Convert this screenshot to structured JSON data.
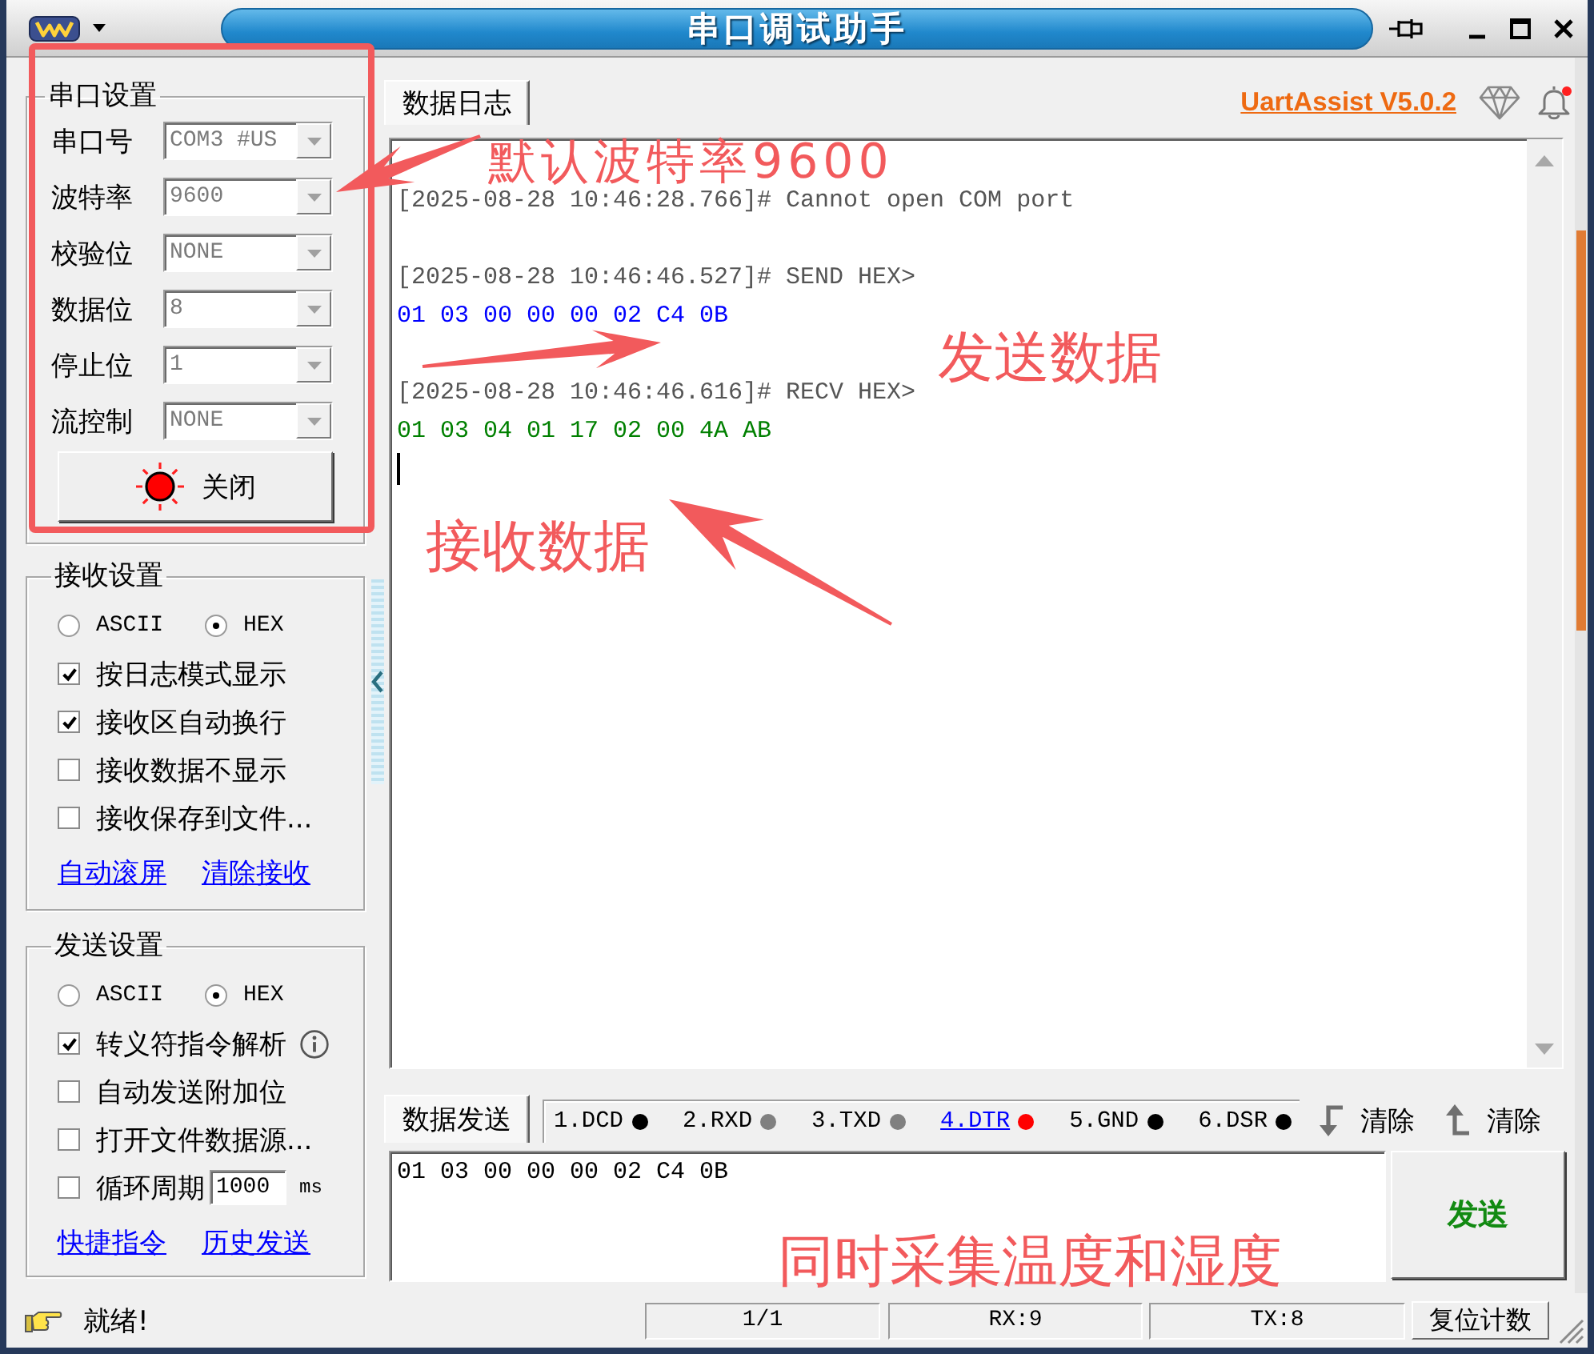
{
  "window": {
    "title": "串口调试助手"
  },
  "serial_settings": {
    "title": "串口设置",
    "fields": [
      {
        "label": "串口号",
        "value": "COM3 #US",
        "disabled": true
      },
      {
        "label": "波特率",
        "value": "9600",
        "disabled": true
      },
      {
        "label": "校验位",
        "value": "NONE",
        "disabled": true
      },
      {
        "label": "数据位",
        "value": "8",
        "disabled": true
      },
      {
        "label": "停止位",
        "value": "1",
        "disabled": true
      },
      {
        "label": "流控制",
        "value": "NONE",
        "disabled": true
      }
    ],
    "toggle_button": {
      "label": "关闭",
      "lamp_on": true
    }
  },
  "receive_settings": {
    "title": "接收设置",
    "formats": [
      {
        "label": "ASCII",
        "selected": false
      },
      {
        "label": "HEX",
        "selected": true
      }
    ],
    "options": [
      {
        "label": "按日志模式显示",
        "checked": true
      },
      {
        "label": "接收区自动换行",
        "checked": true
      },
      {
        "label": "接收数据不显示",
        "checked": false
      },
      {
        "label": "接收保存到文件...",
        "checked": false
      }
    ],
    "links": [
      "自动滚屏",
      "清除接收"
    ]
  },
  "send_settings": {
    "title": "发送设置",
    "formats": [
      {
        "label": "ASCII",
        "selected": false
      },
      {
        "label": "HEX",
        "selected": true
      }
    ],
    "options": [
      {
        "kind": "info",
        "label": "转义符指令解析",
        "checked": true
      },
      {
        "kind": "plain",
        "label": "自动发送附加位",
        "checked": false
      },
      {
        "kind": "plain",
        "label": "打开文件数据源...",
        "checked": false
      },
      {
        "kind": "period",
        "label": "循环周期",
        "checked": false,
        "value": "1000",
        "unit": "ms"
      }
    ],
    "links": [
      "快捷指令",
      "历史发送"
    ]
  },
  "log_panel": {
    "tab": "数据日志",
    "brand_link": "UartAssist V5.0.2",
    "lines": [
      {
        "kind": "info",
        "text": "[2025-08-28 10:46:28.766]# Cannot open COM port"
      },
      {
        "kind": "blank"
      },
      {
        "kind": "info",
        "text": "[2025-08-28 10:46:46.527]# SEND HEX>"
      },
      {
        "kind": "sent",
        "text": "01 03 00 00 00 02 C4 0B"
      },
      {
        "kind": "blank"
      },
      {
        "kind": "info",
        "text": "[2025-08-28 10:46:46.616]# RECV HEX>"
      },
      {
        "kind": "received",
        "text": "01 03 04 01 17 02 00 4A AB"
      }
    ]
  },
  "send_panel": {
    "tab": "数据发送",
    "pins": [
      {
        "label": "1.DCD",
        "color": "#000000",
        "active": false
      },
      {
        "label": "2.RXD",
        "color": "#808080",
        "active": false
      },
      {
        "label": "3.TXD",
        "color": "#808080",
        "active": false
      },
      {
        "label": "4.DTR",
        "color": "#ff0000",
        "active": true
      },
      {
        "label": "5.GND",
        "color": "#000000",
        "active": false
      },
      {
        "label": "6.DSR",
        "color": "#000000",
        "active": false
      }
    ],
    "clear_buttons": [
      {
        "kind": "down",
        "label": "清除"
      },
      {
        "kind": "up",
        "label": "清除"
      }
    ],
    "input": {
      "value": "01 03 00 00 00 02 C4 0B"
    },
    "send_button": "发送"
  },
  "status_bar": {
    "message": "就绪!",
    "cells": [
      "1/1",
      "RX:9",
      "TX:8"
    ],
    "reset_button": "复位计数"
  },
  "annotations": [
    {
      "kind": "frame"
    },
    {
      "kind": "arrow"
    },
    {
      "kind": "label",
      "text": "默认波特率9600"
    },
    {
      "kind": "arrow"
    },
    {
      "kind": "label",
      "text": "发送数据"
    },
    {
      "kind": "arrow"
    },
    {
      "kind": "label",
      "text": "接收数据"
    },
    {
      "kind": "label",
      "text": "同时采集温度和湿度"
    }
  ]
}
